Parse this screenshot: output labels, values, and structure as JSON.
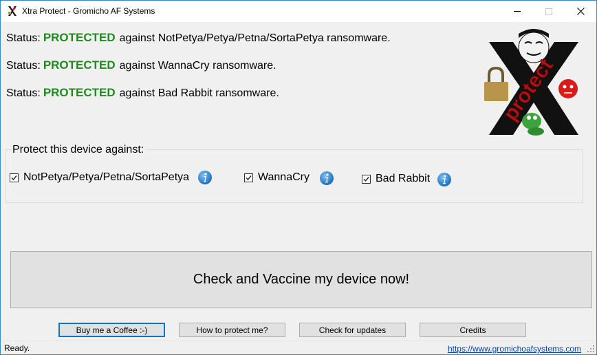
{
  "window": {
    "title": "Xtra Protect - Gromicho AF Systems",
    "minimize_icon": "minimize-icon",
    "maximize_icon": "maximize-icon",
    "close_icon": "close-icon"
  },
  "status_lines": [
    {
      "label": "Status:",
      "state": "PROTECTED",
      "text": "against NotPetya/Petya/Petna/SortaPetya ransomware."
    },
    {
      "label": "Status:",
      "state": "PROTECTED",
      "text": "against WannaCry ransomware."
    },
    {
      "label": "Status:",
      "state": "PROTECTED",
      "text": "against Bad Rabbit ransomware."
    }
  ],
  "logo": {
    "icon": "xtra-protect-logo",
    "text": "protect"
  },
  "protect_group": {
    "legend": "Protect this device against:",
    "options": [
      {
        "label": "NotPetya/Petya/Petna/SortaPetya",
        "checked": true,
        "info_icon": "info-icon"
      },
      {
        "label": "WannaCry",
        "checked": true,
        "info_icon": "info-icon"
      },
      {
        "label": "Bad Rabbit",
        "checked": true,
        "info_icon": "info-icon"
      }
    ]
  },
  "main_button": {
    "label": "Check and Vaccine my device now!"
  },
  "buttons": [
    {
      "label": "Buy me a Coffee :-)"
    },
    {
      "label": "How to protect me?"
    },
    {
      "label": "Check for updates"
    },
    {
      "label": "Credits"
    }
  ],
  "statusbar": {
    "status": "Ready.",
    "link": "https://www.gromichoafsystems.com"
  },
  "colors": {
    "protected_green": "#1f8a1f",
    "window_border": "#2b8bd6",
    "focus_blue": "#0078d7",
    "info_blue": "#1f7fd6",
    "link_blue": "#0645ad"
  }
}
